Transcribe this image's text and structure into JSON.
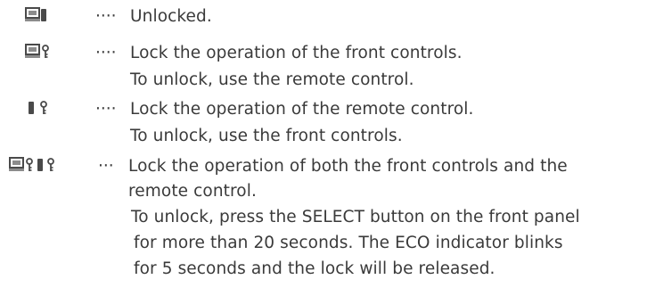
{
  "entries": [
    {
      "icon": "monitor-unlocked-icon",
      "dots": "····",
      "lines": [
        "Unlocked."
      ]
    },
    {
      "icon": "monitor-lock-icon",
      "dots": "····",
      "lines": [
        "Lock the operation of the front controls.",
        "To unlock, use the remote control."
      ]
    },
    {
      "icon": "remote-lock-icon",
      "dots": "····",
      "lines": [
        "Lock the operation of the remote control.",
        "To unlock, use the front controls."
      ]
    },
    {
      "icon": "monitor-and-remote-lock-icon",
      "dots": "···",
      "lines": [
        "Lock the operation of both the front controls and the",
        "remote control.",
        "To unlock, press the SELECT button on the front panel",
        "for more than 20 seconds.  The ECO indicator blinks",
        "for 5 seconds and the lock will be released."
      ]
    }
  ],
  "colors": {
    "text": "#3a3a3a",
    "icon_gray": "#8c8c8c",
    "icon_dark": "#4a4a4a"
  }
}
